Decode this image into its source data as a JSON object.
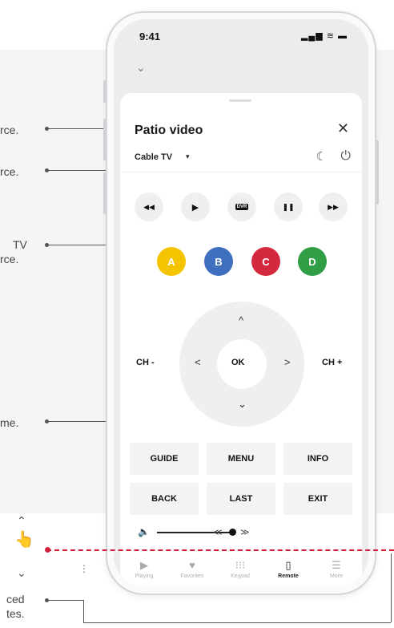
{
  "callouts": {
    "source_tail": "rce.",
    "power_tail": "rce.",
    "colors_tail_1": "TV",
    "colors_tail_2": "rce.",
    "volume_tail": "me.",
    "tabs_tail_1": "ced",
    "tabs_tail_2": "tes."
  },
  "status_bar": {
    "time": "9:41",
    "icons": "▂▄▆ ≋ ▬"
  },
  "header": {
    "chevron": "⌄"
  },
  "panel": {
    "title": "Patio video",
    "close": "✕",
    "source": "Cable TV",
    "source_caret": "▾",
    "sleep_icon": "☾",
    "power_icon": "⏻"
  },
  "transport": [
    {
      "icon": "◀◀",
      "name": "rewind"
    },
    {
      "icon": "▶",
      "name": "play"
    },
    {
      "icon": "DVR",
      "name": "dvr"
    },
    {
      "icon": "❚❚",
      "name": "pause"
    },
    {
      "icon": "▶▶",
      "name": "fast-forward"
    }
  ],
  "color_buttons": [
    {
      "label": "A",
      "color": "#f5c400"
    },
    {
      "label": "B",
      "color": "#3f6fbf"
    },
    {
      "label": "C",
      "color": "#d4283f"
    },
    {
      "label": "D",
      "color": "#2f9e44"
    }
  ],
  "dpad": {
    "up": "^",
    "down": "⌄",
    "left": "<",
    "right": ">",
    "ok": "OK",
    "ch_minus": "CH -",
    "ch_plus": "CH +"
  },
  "keys": [
    "GUIDE",
    "MENU",
    "INFO",
    "BACK",
    "LAST",
    "EXIT"
  ],
  "volume": {
    "icon": "🔈",
    "left_arrows": "≪",
    "right_arrows": "≫",
    "level": 0.95
  },
  "tabs": [
    {
      "icon": "▶",
      "label": "Playing",
      "active": false
    },
    {
      "icon": "♥",
      "label": "Favorites",
      "active": false
    },
    {
      "icon": "⁝⁝⁝",
      "label": "Keypad",
      "active": false
    },
    {
      "icon": "▯",
      "label": "Remote",
      "active": true
    },
    {
      "icon": "☰",
      "label": "More",
      "active": false
    }
  ],
  "overlay": {
    "scroll_up": "⌃",
    "scroll_down": "⌄",
    "hand": "👆",
    "dots": "⋮"
  },
  "colors": {
    "accent_red": "#d0213b"
  }
}
